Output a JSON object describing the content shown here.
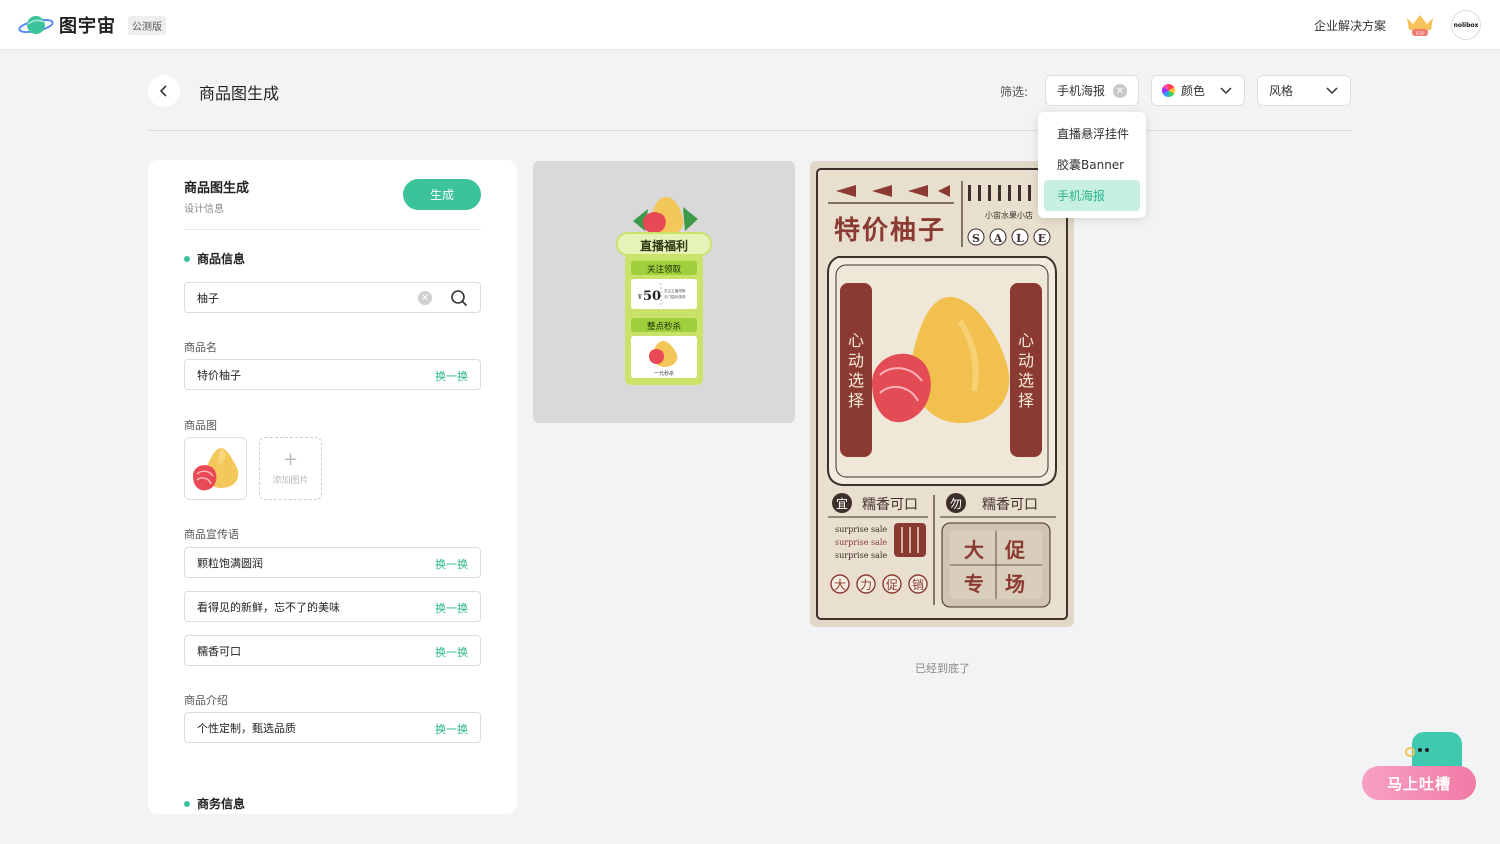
{
  "topbar": {
    "brand": "图宇宙",
    "beta": "公测版",
    "enterprise": "企业解决方案",
    "vip": "VIP",
    "avatar_text": "nolibox"
  },
  "header": {
    "title": "商品图生成",
    "filter_label": "筛选:",
    "filters": {
      "poster": "手机海报",
      "color": "颜色",
      "style": "风格"
    }
  },
  "dropdown": {
    "items": [
      "直播悬浮挂件",
      "胶囊Banner",
      "手机海报"
    ],
    "selected": "手机海报"
  },
  "panel": {
    "title": "商品图生成",
    "subtitle": "设计信息",
    "generate": "生成",
    "section_product": "商品信息",
    "search_value": "柚子",
    "name_label": "商品名",
    "name_value": "特价柚子",
    "swap": "换一换",
    "image_label": "商品图",
    "add_image": "添加图片",
    "slogan_label": "商品宣传语",
    "slogans": [
      "颗粒饱满圆润",
      "看得见的新鲜，忘不了的美味",
      "糯香可口"
    ],
    "intro_label": "商品介绍",
    "intro_value": "个性定制，甄选品质",
    "section_business": "商务信息"
  },
  "card1": {
    "title": "直播福利",
    "follow": "关注领取",
    "coupon_value": "50",
    "coupon_currency": "¥",
    "coupon_note1": "关注主播领取",
    "coupon_note2": "无门槛优惠券",
    "flash": "整点秒杀",
    "flash_tag": "一元秒杀"
  },
  "card2": {
    "headline": "特价柚子",
    "shop": "小宙水果小店",
    "sale_letters": [
      "S",
      "A",
      "L",
      "E"
    ],
    "side_text": [
      "心",
      "动",
      "选",
      "择"
    ],
    "yi": "宜",
    "wu": "勿",
    "tagline": "糯香可口",
    "surprise": [
      "surprise sale",
      "surprise sale",
      "surprise sale"
    ],
    "circle_chars": [
      "大",
      "力",
      "促",
      "销"
    ],
    "big_chars": [
      "大",
      "促",
      "专",
      "场"
    ]
  },
  "bottom_note": "已经到底了",
  "feedback": "马上吐槽",
  "colors": {
    "accent": "#3cc39b",
    "poster_red": "#8b3a32",
    "poster_bg": "#e1d7c6"
  }
}
